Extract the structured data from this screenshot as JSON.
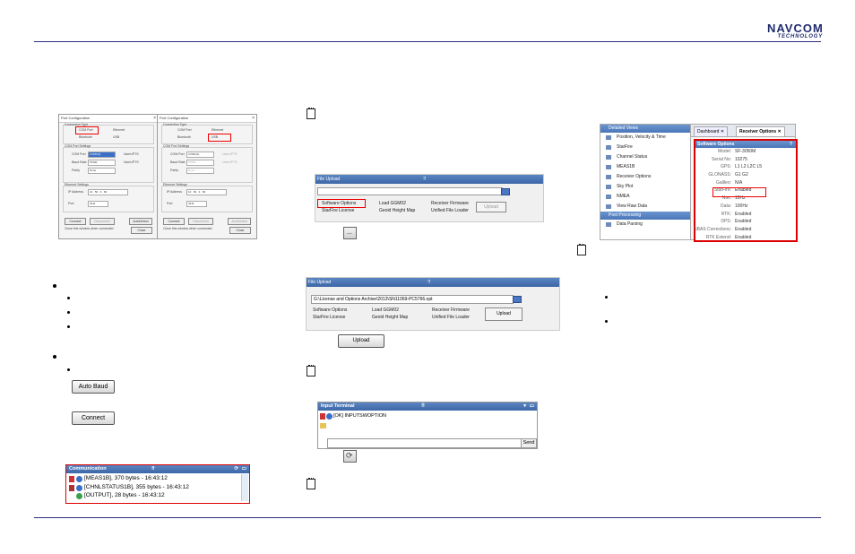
{
  "brand": {
    "name": "NAVCOM",
    "tagline": "TECHNOLOGY",
    "color": "#1f2b6e"
  },
  "port_config": [
    {
      "title": "Port Configuration",
      "connection_type_label": "Connection Type",
      "options": [
        "COM Port",
        "Ethernet",
        "Bluetooth",
        "USB"
      ],
      "com_settings_label": "COM Port Settings",
      "com_port_label": "COM Port",
      "com_port_value": "COM1(3)",
      "baud_label": "Baud Rate",
      "baud_value": "57600",
      "parity_label": "Parity",
      "parity_value": "None",
      "uart_labels": [
        "UserUPTS",
        "UserUPTS"
      ],
      "ethernet_label": "Ethernet Settings",
      "ip_label": "IP Address",
      "ip_value": "10 . 50 . 3 . 60",
      "port_label": "Port",
      "port_value": "4411",
      "connect": "Connect",
      "disconnect": "Disconnect",
      "autodetect": "AutoDetect",
      "close_check": "Close this window when connected",
      "close": "Close"
    },
    {
      "title": "Port Configuration",
      "connection_type_label": "Connection Type",
      "options": [
        "COM Port",
        "Ethernet",
        "Bluetooth",
        "USB"
      ],
      "com_settings_label": "COM Port Settings",
      "com_port_label": "COM Port",
      "com_port_value": "COM1(3)",
      "baud_label": "Baud Rate",
      "baud_value": "57600",
      "parity_label": "Parity",
      "parity_value": "None",
      "uart_labels": [
        "UserUPTS",
        "UserUPTS"
      ],
      "ethernet_label": "Ethernet Settings",
      "ip_label": "IP Address",
      "ip_value": "10 . 50 . 3 . 60",
      "port_label": "Port",
      "port_value": "4411",
      "connect": "Connect",
      "disconnect": "Disconnect",
      "autodetect": "AutoDetect",
      "close_check": "Close this window when connected",
      "close": "Close"
    }
  ],
  "file_upload_1": {
    "title": "File Upload",
    "path": "",
    "options": [
      "Software Options",
      "Load GGM02",
      "Receiver Firmware",
      "StarFire License",
      "Geoid Height Map",
      "Unified File Loader"
    ],
    "upload": "Upload"
  },
  "file_upload_2": {
    "title": "File Upload",
    "path": "G:\\License and Options Archive\\2013\\SN11069-PC5766.opt",
    "options": [
      "Software Options",
      "Load GGM02",
      "Receiver Firmware",
      "StarFire License",
      "Geoid Height Map",
      "Unified File Loader"
    ],
    "upload": "Upload"
  },
  "upload_button": "Upload",
  "buttons": {
    "auto_baud": "Auto Baud",
    "connect": "Connect"
  },
  "terminal": {
    "title": "Input Terminal",
    "line": "[OK] INPUTSWOPTION",
    "send": "Send"
  },
  "communication": {
    "title": "Communication",
    "lines": [
      "[MEAS1B], 370 bytes - 16:43:12",
      "[CHNLSTATUS1B], 355 bytes - 16:43:12",
      "[OUTPUT], 28 bytes - 16:43:12"
    ]
  },
  "receiver_options": {
    "side_header": "Detailed Views",
    "side_items": [
      "Position, Velocity & Time",
      "StarFire",
      "Channel Status",
      "MEAS1B",
      "Receiver Options",
      "Sky Plot",
      "NMEA",
      "View Raw Data"
    ],
    "side_header2": "Post Processing",
    "side_items2": [
      "Data Parsing"
    ],
    "tabs": [
      "Dashboard",
      "Receiver Options"
    ],
    "panel_title": "Software Options",
    "rows": [
      {
        "k": "Model:",
        "v": "SF-3050M"
      },
      {
        "k": "Serial No:",
        "v": "10275"
      },
      {
        "k": "GPS:",
        "v": "L1 L2 L2C L5"
      },
      {
        "k": "GLONASS:",
        "v": "G1 G2"
      },
      {
        "k": "Galileo:",
        "v": "N/A"
      },
      {
        "k": "StarFire:",
        "v": "Enabled"
      },
      {
        "k": "Nav:",
        "v": "10Hz"
      },
      {
        "k": "Data:",
        "v": "100Hz"
      },
      {
        "k": "RTK:",
        "v": "Enabled"
      },
      {
        "k": "DPS:",
        "v": "Enabled"
      },
      {
        "k": "SBAS Corrections:",
        "v": "Enabled"
      },
      {
        "k": "RTK Extend:",
        "v": "Enabled"
      }
    ]
  }
}
